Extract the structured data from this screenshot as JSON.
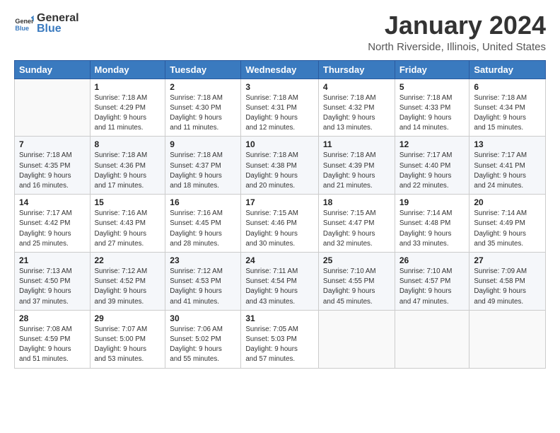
{
  "header": {
    "logo_general": "General",
    "logo_blue": "Blue",
    "title": "January 2024",
    "subtitle": "North Riverside, Illinois, United States"
  },
  "days_of_week": [
    "Sunday",
    "Monday",
    "Tuesday",
    "Wednesday",
    "Thursday",
    "Friday",
    "Saturday"
  ],
  "weeks": [
    [
      {
        "day": "",
        "info": ""
      },
      {
        "day": "1",
        "info": "Sunrise: 7:18 AM\nSunset: 4:29 PM\nDaylight: 9 hours\nand 11 minutes."
      },
      {
        "day": "2",
        "info": "Sunrise: 7:18 AM\nSunset: 4:30 PM\nDaylight: 9 hours\nand 11 minutes."
      },
      {
        "day": "3",
        "info": "Sunrise: 7:18 AM\nSunset: 4:31 PM\nDaylight: 9 hours\nand 12 minutes."
      },
      {
        "day": "4",
        "info": "Sunrise: 7:18 AM\nSunset: 4:32 PM\nDaylight: 9 hours\nand 13 minutes."
      },
      {
        "day": "5",
        "info": "Sunrise: 7:18 AM\nSunset: 4:33 PM\nDaylight: 9 hours\nand 14 minutes."
      },
      {
        "day": "6",
        "info": "Sunrise: 7:18 AM\nSunset: 4:34 PM\nDaylight: 9 hours\nand 15 minutes."
      }
    ],
    [
      {
        "day": "7",
        "info": "Sunrise: 7:18 AM\nSunset: 4:35 PM\nDaylight: 9 hours\nand 16 minutes."
      },
      {
        "day": "8",
        "info": "Sunrise: 7:18 AM\nSunset: 4:36 PM\nDaylight: 9 hours\nand 17 minutes."
      },
      {
        "day": "9",
        "info": "Sunrise: 7:18 AM\nSunset: 4:37 PM\nDaylight: 9 hours\nand 18 minutes."
      },
      {
        "day": "10",
        "info": "Sunrise: 7:18 AM\nSunset: 4:38 PM\nDaylight: 9 hours\nand 20 minutes."
      },
      {
        "day": "11",
        "info": "Sunrise: 7:18 AM\nSunset: 4:39 PM\nDaylight: 9 hours\nand 21 minutes."
      },
      {
        "day": "12",
        "info": "Sunrise: 7:17 AM\nSunset: 4:40 PM\nDaylight: 9 hours\nand 22 minutes."
      },
      {
        "day": "13",
        "info": "Sunrise: 7:17 AM\nSunset: 4:41 PM\nDaylight: 9 hours\nand 24 minutes."
      }
    ],
    [
      {
        "day": "14",
        "info": "Sunrise: 7:17 AM\nSunset: 4:42 PM\nDaylight: 9 hours\nand 25 minutes."
      },
      {
        "day": "15",
        "info": "Sunrise: 7:16 AM\nSunset: 4:43 PM\nDaylight: 9 hours\nand 27 minutes."
      },
      {
        "day": "16",
        "info": "Sunrise: 7:16 AM\nSunset: 4:45 PM\nDaylight: 9 hours\nand 28 minutes."
      },
      {
        "day": "17",
        "info": "Sunrise: 7:15 AM\nSunset: 4:46 PM\nDaylight: 9 hours\nand 30 minutes."
      },
      {
        "day": "18",
        "info": "Sunrise: 7:15 AM\nSunset: 4:47 PM\nDaylight: 9 hours\nand 32 minutes."
      },
      {
        "day": "19",
        "info": "Sunrise: 7:14 AM\nSunset: 4:48 PM\nDaylight: 9 hours\nand 33 minutes."
      },
      {
        "day": "20",
        "info": "Sunrise: 7:14 AM\nSunset: 4:49 PM\nDaylight: 9 hours\nand 35 minutes."
      }
    ],
    [
      {
        "day": "21",
        "info": "Sunrise: 7:13 AM\nSunset: 4:50 PM\nDaylight: 9 hours\nand 37 minutes."
      },
      {
        "day": "22",
        "info": "Sunrise: 7:12 AM\nSunset: 4:52 PM\nDaylight: 9 hours\nand 39 minutes."
      },
      {
        "day": "23",
        "info": "Sunrise: 7:12 AM\nSunset: 4:53 PM\nDaylight: 9 hours\nand 41 minutes."
      },
      {
        "day": "24",
        "info": "Sunrise: 7:11 AM\nSunset: 4:54 PM\nDaylight: 9 hours\nand 43 minutes."
      },
      {
        "day": "25",
        "info": "Sunrise: 7:10 AM\nSunset: 4:55 PM\nDaylight: 9 hours\nand 45 minutes."
      },
      {
        "day": "26",
        "info": "Sunrise: 7:10 AM\nSunset: 4:57 PM\nDaylight: 9 hours\nand 47 minutes."
      },
      {
        "day": "27",
        "info": "Sunrise: 7:09 AM\nSunset: 4:58 PM\nDaylight: 9 hours\nand 49 minutes."
      }
    ],
    [
      {
        "day": "28",
        "info": "Sunrise: 7:08 AM\nSunset: 4:59 PM\nDaylight: 9 hours\nand 51 minutes."
      },
      {
        "day": "29",
        "info": "Sunrise: 7:07 AM\nSunset: 5:00 PM\nDaylight: 9 hours\nand 53 minutes."
      },
      {
        "day": "30",
        "info": "Sunrise: 7:06 AM\nSunset: 5:02 PM\nDaylight: 9 hours\nand 55 minutes."
      },
      {
        "day": "31",
        "info": "Sunrise: 7:05 AM\nSunset: 5:03 PM\nDaylight: 9 hours\nand 57 minutes."
      },
      {
        "day": "",
        "info": ""
      },
      {
        "day": "",
        "info": ""
      },
      {
        "day": "",
        "info": ""
      }
    ]
  ]
}
